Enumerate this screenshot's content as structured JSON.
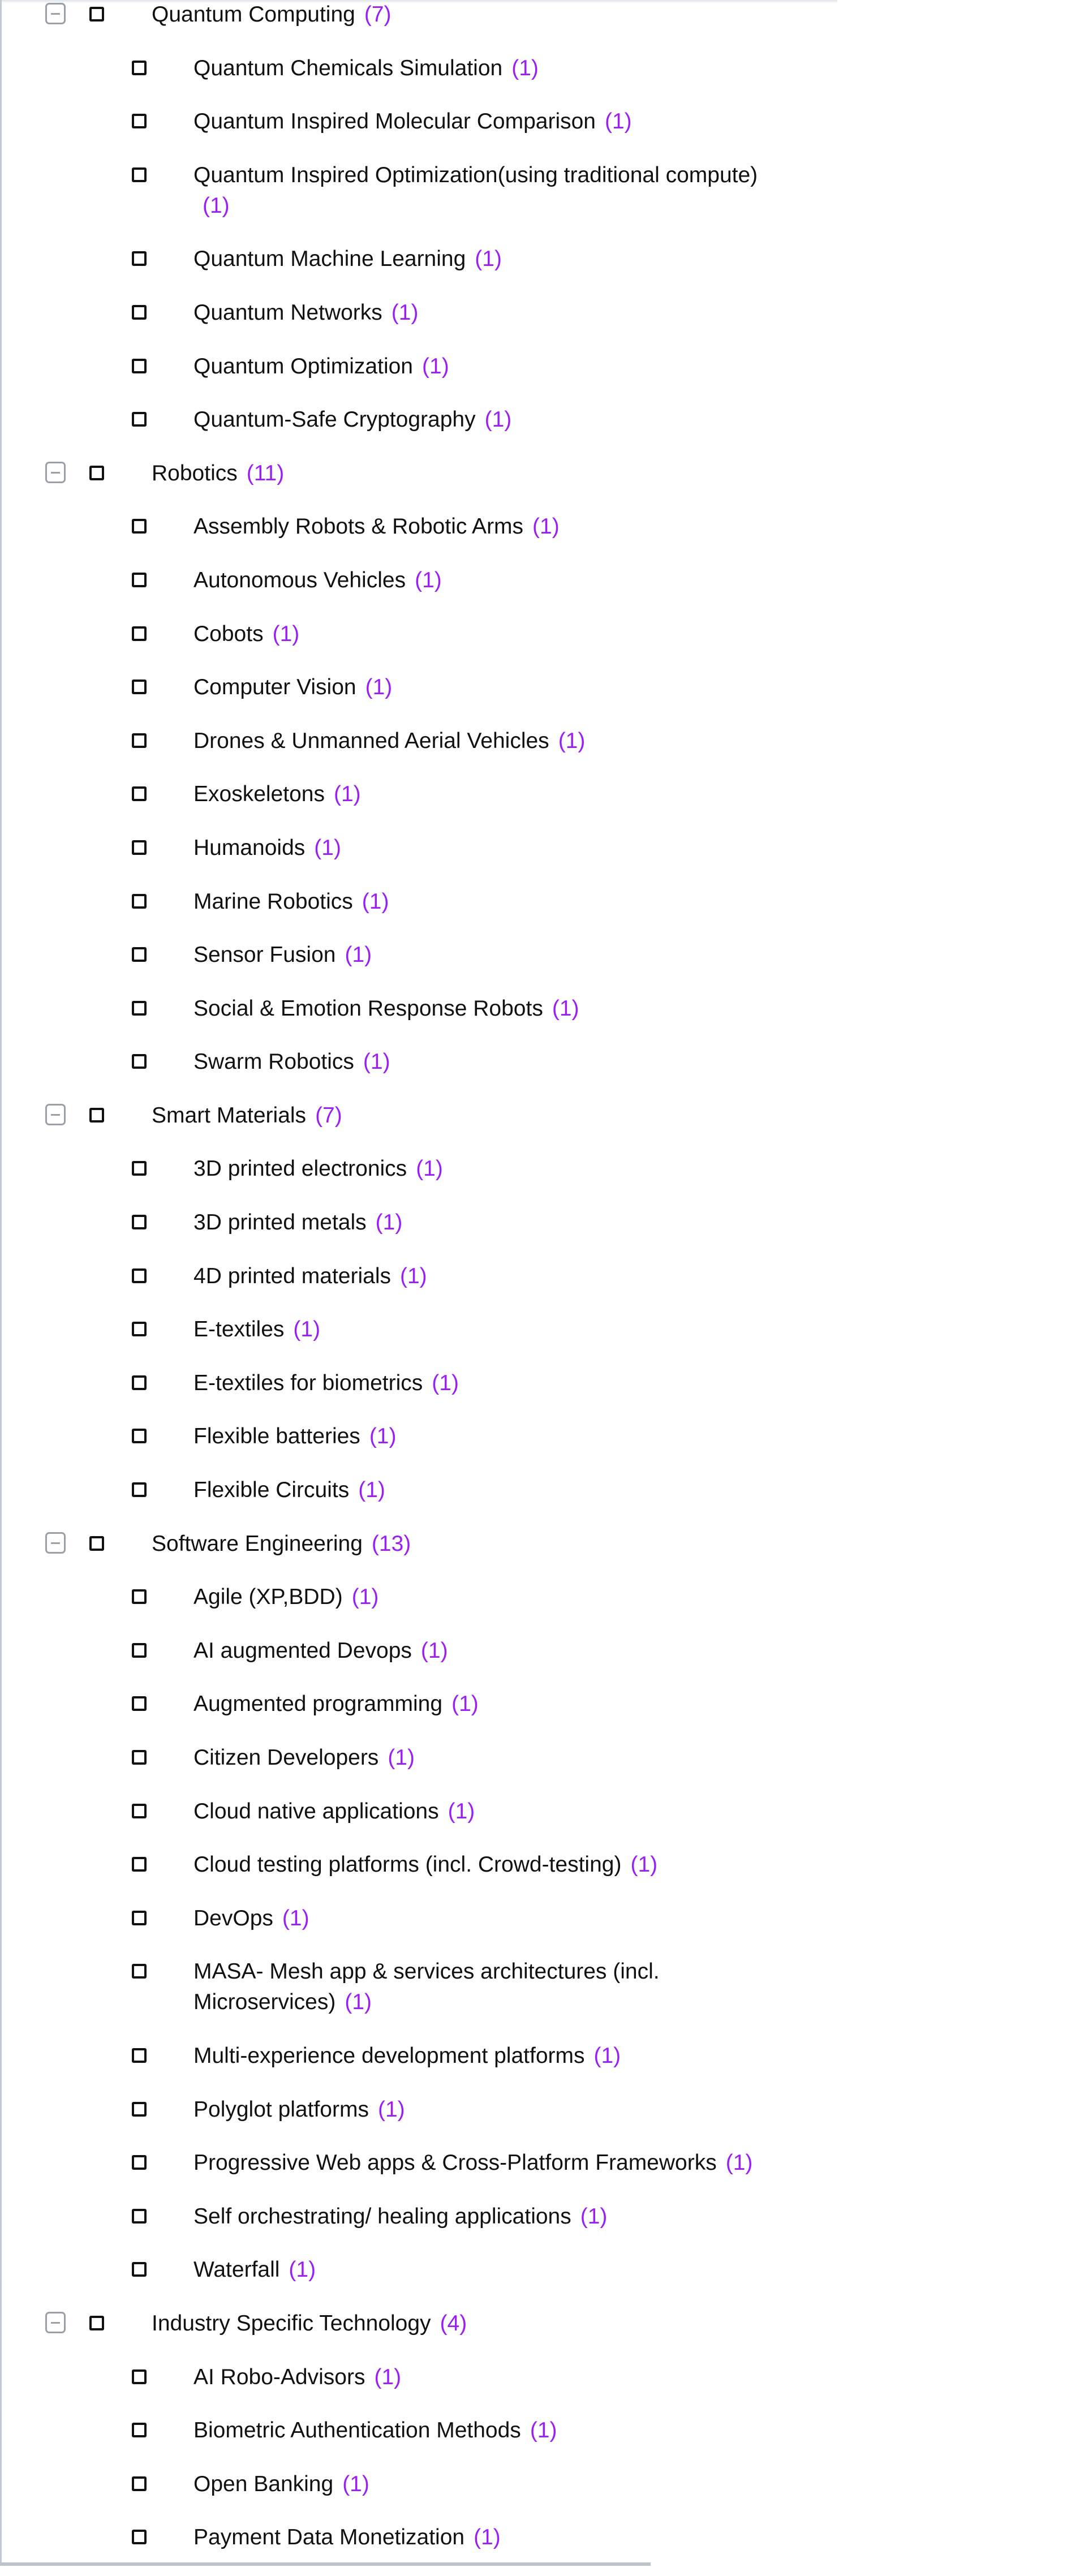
{
  "colors": {
    "count": "#9b1ff5",
    "checkbox_border": "#111111",
    "toggle_border": "#9aa0a6"
  },
  "groups": [
    {
      "label": "Quantum Computing",
      "count": "(7)",
      "expanded": true,
      "items": [
        {
          "label": "Quantum Chemicals Simulation",
          "count": "(1)"
        },
        {
          "label": "Quantum Inspired Molecular Comparison",
          "count": "(1)"
        },
        {
          "label": "Quantum Inspired Optimization(using traditional compute)",
          "count": "(1)"
        },
        {
          "label": "Quantum Machine Learning",
          "count": "(1)"
        },
        {
          "label": "Quantum Networks",
          "count": "(1)"
        },
        {
          "label": "Quantum Optimization",
          "count": "(1)"
        },
        {
          "label": "Quantum-Safe Cryptography",
          "count": "(1)"
        }
      ]
    },
    {
      "label": "Robotics",
      "count": "(11)",
      "expanded": true,
      "items": [
        {
          "label": "Assembly Robots & Robotic Arms",
          "count": "(1)"
        },
        {
          "label": "Autonomous Vehicles",
          "count": "(1)"
        },
        {
          "label": "Cobots",
          "count": "(1)"
        },
        {
          "label": "Computer Vision",
          "count": "(1)"
        },
        {
          "label": "Drones & Unmanned Aerial Vehicles",
          "count": "(1)"
        },
        {
          "label": "Exoskeletons",
          "count": "(1)"
        },
        {
          "label": "Humanoids",
          "count": "(1)"
        },
        {
          "label": "Marine Robotics",
          "count": "(1)"
        },
        {
          "label": "Sensor Fusion",
          "count": "(1)"
        },
        {
          "label": "Social & Emotion Response Robots",
          "count": "(1)"
        },
        {
          "label": "Swarm Robotics",
          "count": "(1)"
        }
      ]
    },
    {
      "label": "Smart Materials",
      "count": "(7)",
      "expanded": true,
      "items": [
        {
          "label": "3D printed electronics",
          "count": "(1)"
        },
        {
          "label": "3D printed metals",
          "count": "(1)"
        },
        {
          "label": "4D printed materials",
          "count": "(1)"
        },
        {
          "label": "E-textiles",
          "count": "(1)"
        },
        {
          "label": "E-textiles for biometrics",
          "count": "(1)"
        },
        {
          "label": "Flexible batteries",
          "count": "(1)"
        },
        {
          "label": "Flexible Circuits",
          "count": "(1)"
        }
      ]
    },
    {
      "label": "Software Engineering",
      "count": "(13)",
      "expanded": true,
      "items": [
        {
          "label": "Agile (XP,BDD)",
          "count": "(1)"
        },
        {
          "label": "AI augmented Devops",
          "count": "(1)"
        },
        {
          "label": "Augmented programming",
          "count": "(1)"
        },
        {
          "label": "Citizen Developers",
          "count": "(1)"
        },
        {
          "label": "Cloud native applications",
          "count": "(1)"
        },
        {
          "label": "Cloud testing platforms (incl. Crowd-testing)",
          "count": "(1)"
        },
        {
          "label": "DevOps",
          "count": "(1)"
        },
        {
          "label": "MASA- Mesh app & services architectures (incl. Microservices)",
          "count": "(1)"
        },
        {
          "label": "Multi-experience development platforms",
          "count": "(1)"
        },
        {
          "label": "Polyglot platforms",
          "count": "(1)"
        },
        {
          "label": "Progressive Web apps & Cross-Platform Frameworks",
          "count": "(1)"
        },
        {
          "label": "Self orchestrating/ healing applications",
          "count": "(1)"
        },
        {
          "label": "Waterfall",
          "count": "(1)"
        }
      ]
    },
    {
      "label": "Industry Specific Technology",
      "count": "(4)",
      "expanded": true,
      "items": [
        {
          "label": "AI Robo-Advisors",
          "count": "(1)"
        },
        {
          "label": "Biometric Authentication Methods",
          "count": "(1)"
        },
        {
          "label": "Open Banking",
          "count": "(1)"
        },
        {
          "label": "Payment Data Monetization",
          "count": "(1)"
        }
      ]
    }
  ]
}
